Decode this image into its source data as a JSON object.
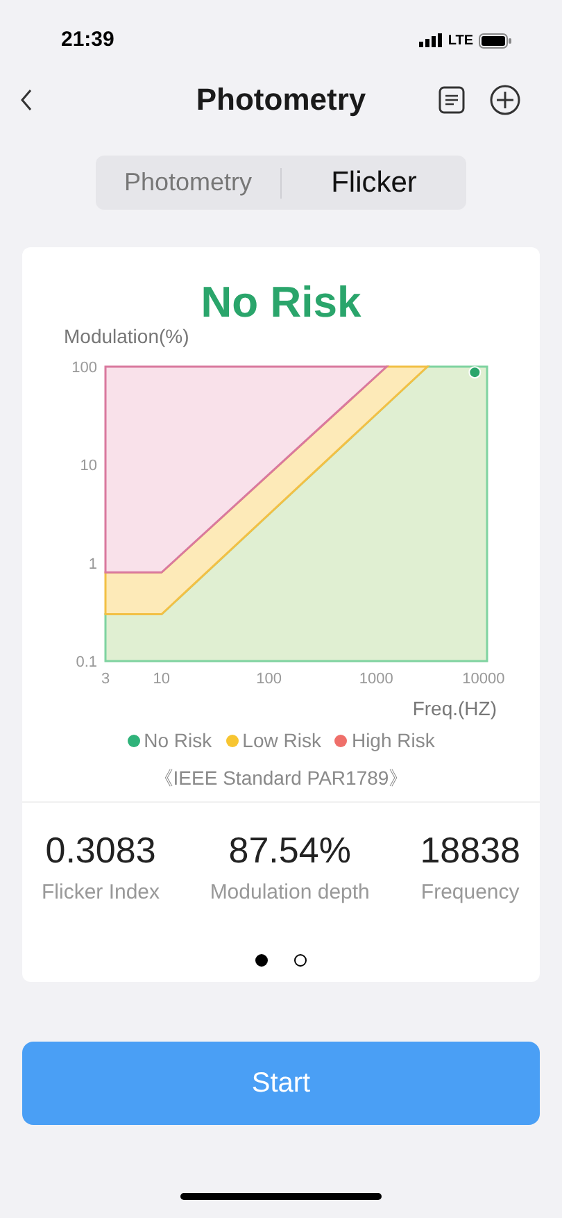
{
  "status_bar": {
    "time": "21:39",
    "network": "LTE"
  },
  "nav": {
    "title": "Photometry"
  },
  "tabs": [
    {
      "label": "Photometry",
      "selected": false
    },
    {
      "label": "Flicker",
      "selected": true
    }
  ],
  "result": {
    "title": "No Risk",
    "color": "#2aa56b"
  },
  "chart": {
    "ylabel": "Modulation(%)",
    "xlabel": "Freq.(HZ)",
    "y_tick_labels": [
      "100",
      "10",
      "1",
      "0.1"
    ],
    "x_tick_labels": [
      "3",
      "10",
      "100",
      "1000",
      "10000"
    ]
  },
  "legend": [
    {
      "label": "No Risk",
      "color": "#2fb37a"
    },
    {
      "label": "Low Risk",
      "color": "#f7c531"
    },
    {
      "label": "High Risk",
      "color": "#ef6f6a"
    }
  ],
  "standard": "《IEEE Standard PAR1789》",
  "stats": [
    {
      "value": "0.3083",
      "label": "Flicker Index"
    },
    {
      "value": "87.54%",
      "label": "Modulation depth"
    },
    {
      "value": "18838",
      "label": "Frequency"
    }
  ],
  "pager": [
    {
      "selected": true
    },
    {
      "selected": false
    }
  ],
  "start_button": "Start"
}
